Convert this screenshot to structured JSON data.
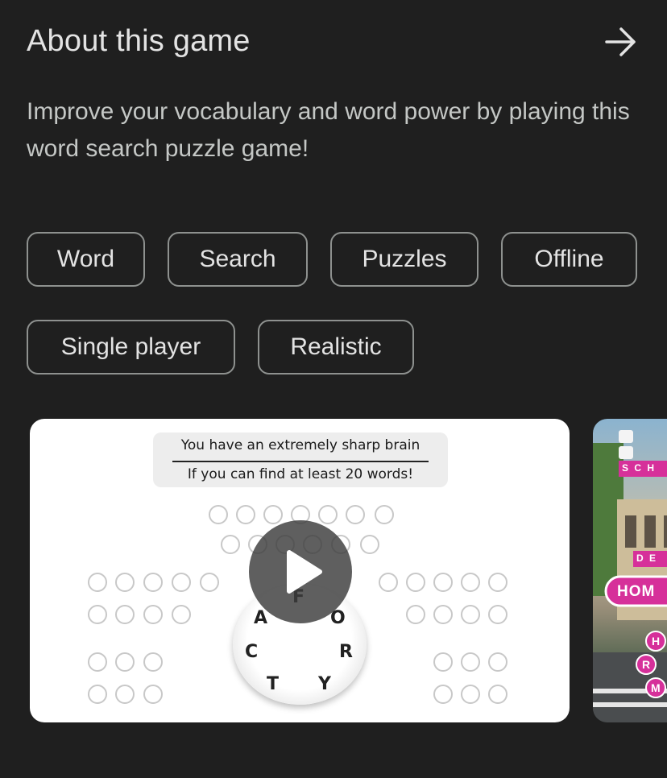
{
  "section": {
    "title": "About this game",
    "arrow_icon": "arrow-right-icon",
    "description": "Improve your vocabulary and word power by playing this word search puzzle game!"
  },
  "tags": [
    "Word",
    "Search",
    "Puzzles",
    "Offline",
    "Single player",
    "Realistic"
  ],
  "screenshot1": {
    "banner_line1": "You have an extremely sharp brain",
    "banner_line2": "If you can find at least 20 words!",
    "wheel_letters": [
      "F",
      "A",
      "O",
      "C",
      "R",
      "T",
      "Y"
    ],
    "play_icon": "play-icon"
  },
  "screenshot2": {
    "tile_1": "S C H",
    "tile_2": "D E",
    "sign": "HOM",
    "bubble_letters": [
      "H",
      "R",
      "M"
    ]
  },
  "colors": {
    "background": "#1f1f1f",
    "text": "#e3e3e3",
    "chip_border": "#8e918f",
    "accent_pink": "#d6309a"
  }
}
